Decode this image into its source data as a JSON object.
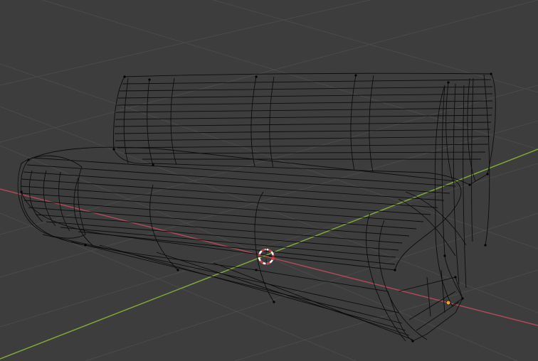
{
  "viewport": {
    "mode": "wireframe",
    "object": "bench-mesh",
    "colors": {
      "background": "#3d3d3d",
      "grid": "#4a4a4a",
      "x_axis": "#b04a57",
      "y_axis": "#7ea83a",
      "wire": "#0a0a0a",
      "vertex": "#000000",
      "cursor_red": "#d23a3a",
      "cursor_white": "#ffffff",
      "origin": "#e8a33a"
    },
    "icons": {
      "cursor": "3d-cursor-icon",
      "origin": "object-origin-icon"
    }
  }
}
